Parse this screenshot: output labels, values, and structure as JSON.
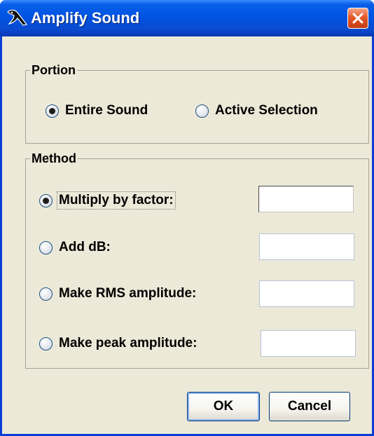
{
  "window": {
    "title": "Amplify Sound",
    "app_icon": "bird-icon",
    "close_icon": "close-icon",
    "colors": {
      "titlebar": "#0054e3",
      "frame": "#0a3fd6",
      "face": "#ece9d8",
      "close_button": "#e55a2a"
    }
  },
  "portion": {
    "legend": "Portion",
    "options": [
      {
        "label": "Entire Sound",
        "checked": true
      },
      {
        "label": "Active Selection",
        "checked": false
      }
    ]
  },
  "method": {
    "legend": "Method",
    "options": [
      {
        "label": "Multiply by factor:",
        "checked": true,
        "value": ""
      },
      {
        "label": "Add dB:",
        "checked": false,
        "value": ""
      },
      {
        "label": "Make RMS amplitude:",
        "checked": false,
        "value": ""
      },
      {
        "label": "Make peak amplitude:",
        "checked": false,
        "value": ""
      }
    ]
  },
  "buttons": {
    "ok_label": "OK",
    "cancel_label": "Cancel"
  }
}
